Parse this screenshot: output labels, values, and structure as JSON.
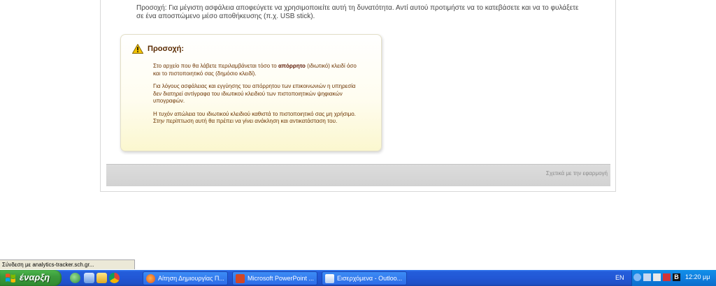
{
  "intro": {
    "line1": "Προσοχή: Για μέγιστη ασφάλεια αποφεύγετε να χρησιμοποιείτε αυτή τη δυνατότητα. Αντί αυτού προτιμήστε να το κατεβάσετε και να το φυλάξετε",
    "line2": "σε ένα αποσπώμενο μέσο αποθήκευσης (π.χ. USB stick)."
  },
  "warning": {
    "title": "Προσοχή:",
    "p1_before": "Στο αρχείο που θα λάβετε περιλαμβάνεται τόσο το ",
    "p1_bold": "απόρρητο",
    "p1_after": " (ιδιωτικό) κλειδί όσο και το πιστοποιητικό σας (δημόσιο κλειδί).",
    "p2": "Για λόγους ασφάλειας και εγγύησης του απόρρητου των επικοινωνιών η υπηρεσία δεν διατηρεί αντίγραφα του ιδιωτικού κλειδιού των πιστοποιητικών ψηφιακών υπογραφών.",
    "p3": "Η τυχόν απώλεια του ιδιωτικού κλειδιού καθιστά το πιστοποιητικό σας μη χρήσιμο. Στην περίπτωση αυτή θα πρέπει να γίνει ανάκληση και αντικατάσταση του."
  },
  "footer": {
    "about_link": "Σχετικά με την εφαρμογή"
  },
  "status_bar": {
    "text": "Σύνδεση με analytics-tracker.sch.gr..."
  },
  "taskbar": {
    "start_label": "έναρξη",
    "tasks": [
      {
        "label": "Αίτηση Δημιουργίας Π...",
        "icon": "firefox-icon"
      },
      {
        "label": "Microsoft PowerPoint ...",
        "icon": "powerpoint-icon"
      },
      {
        "label": "Εισερχόμενα - Outloo...",
        "icon": "outlook-icon"
      }
    ],
    "language": "EN",
    "clock": "12:20 μμ"
  },
  "colors": {
    "warning_text": "#6b3300",
    "taskbar_blue": "#245edb",
    "start_green": "#3c9b3c",
    "tray_blue": "#0f7ede"
  }
}
